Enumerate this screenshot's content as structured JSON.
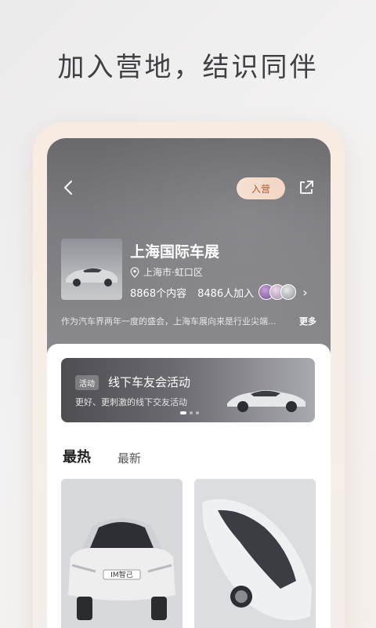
{
  "headline": "加入营地，结识同伴",
  "header": {
    "join_label": "入营"
  },
  "camp": {
    "name": "上海国际车展",
    "location": "上海市·虹口区",
    "content_count": "8868个内容",
    "member_count": "8486人加入",
    "description": "作为汽车界两年一度的盛会，上海车展向来是行业尖端...",
    "more_label": "更多"
  },
  "banner": {
    "tag": "活动",
    "title": "线下车友会活动",
    "subtitle": "更好、更刺激的线下交友活动"
  },
  "tabs": [
    {
      "label": "最热",
      "active": true
    },
    {
      "label": "最新",
      "active": false
    }
  ],
  "cards": [
    {
      "badge": "IM智己"
    },
    {
      "badge": ""
    }
  ],
  "colors": {
    "accent": "#b35a2e",
    "join_bg": "#f4d9c8"
  }
}
